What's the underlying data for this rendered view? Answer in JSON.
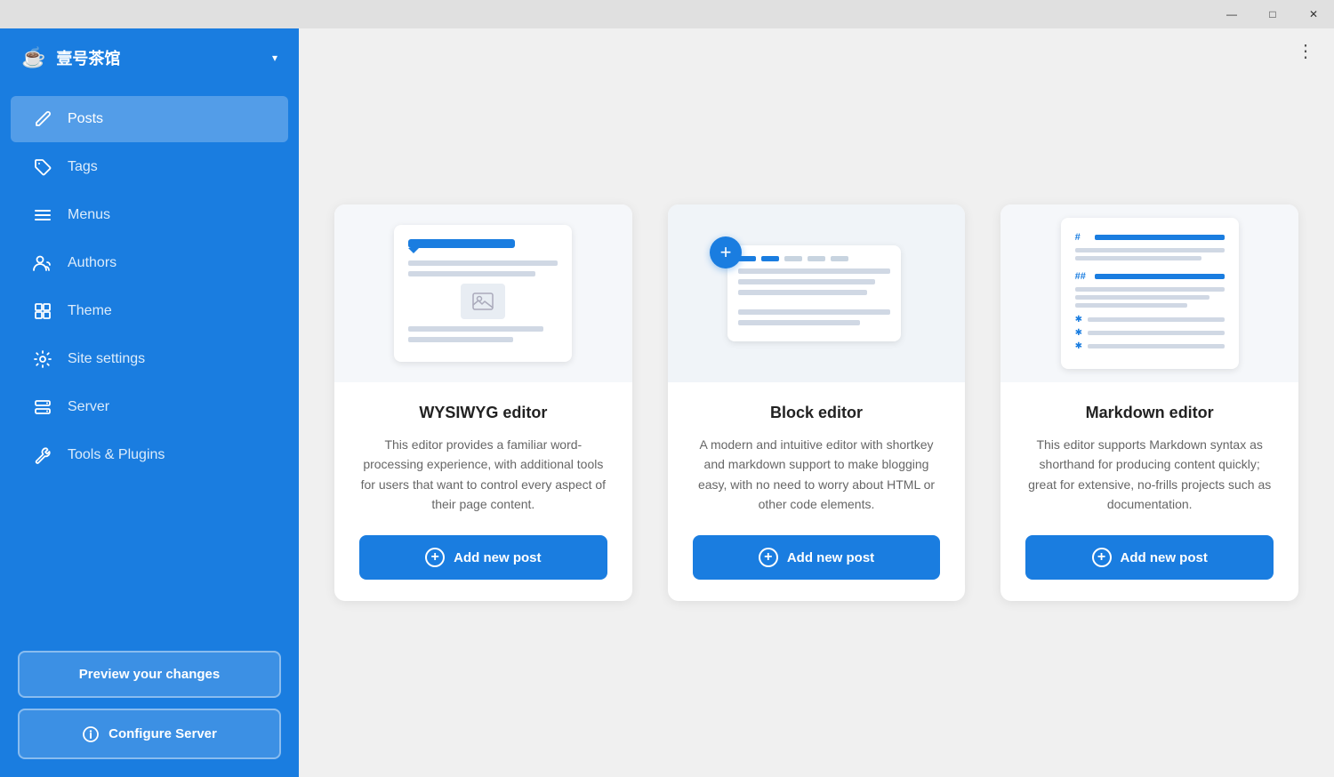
{
  "titlebar": {
    "minimize_label": "—",
    "maximize_label": "□",
    "close_label": "✕"
  },
  "sidebar": {
    "logo": "☕",
    "title": "壹号茶馆",
    "dropdown_icon": "▾",
    "nav_items": [
      {
        "id": "posts",
        "icon": "✏",
        "label": "Posts",
        "active": true
      },
      {
        "id": "tags",
        "icon": "🏷",
        "label": "Tags",
        "active": false
      },
      {
        "id": "menus",
        "icon": "≡",
        "label": "Menus",
        "active": false
      },
      {
        "id": "authors",
        "icon": "👥",
        "label": "Authors",
        "active": false
      },
      {
        "id": "theme",
        "icon": "⚙",
        "label": "Theme",
        "active": false
      },
      {
        "id": "site-settings",
        "icon": "⚙",
        "label": "Site settings",
        "active": false
      },
      {
        "id": "server",
        "icon": "🗄",
        "label": "Server",
        "active": false
      },
      {
        "id": "tools-plugins",
        "icon": "🔧",
        "label": "Tools & Plugins",
        "active": false
      }
    ],
    "footer": {
      "preview_btn": "Preview your changes",
      "configure_btn": "Configure Server",
      "configure_icon": "ⓘ"
    }
  },
  "main": {
    "three_dot": "⋮",
    "cards": [
      {
        "id": "wysiwyg",
        "title": "WYSIWYG editor",
        "description": "This editor provides a familiar word-processing experience, with additional tools for users that want to control every aspect of their page content.",
        "add_btn_label": "Add new post"
      },
      {
        "id": "block",
        "title": "Block editor",
        "description": "A modern and intuitive editor with shortkey and markdown support to make blogging easy, with no need to worry about HTML or other code elements.",
        "add_btn_label": "Add new post"
      },
      {
        "id": "markdown",
        "title": "Markdown editor",
        "description": "This editor supports Markdown syntax as shorthand for producing content quickly; great for extensive, no-frills projects such as documentation.",
        "add_btn_label": "Add new post"
      }
    ]
  }
}
